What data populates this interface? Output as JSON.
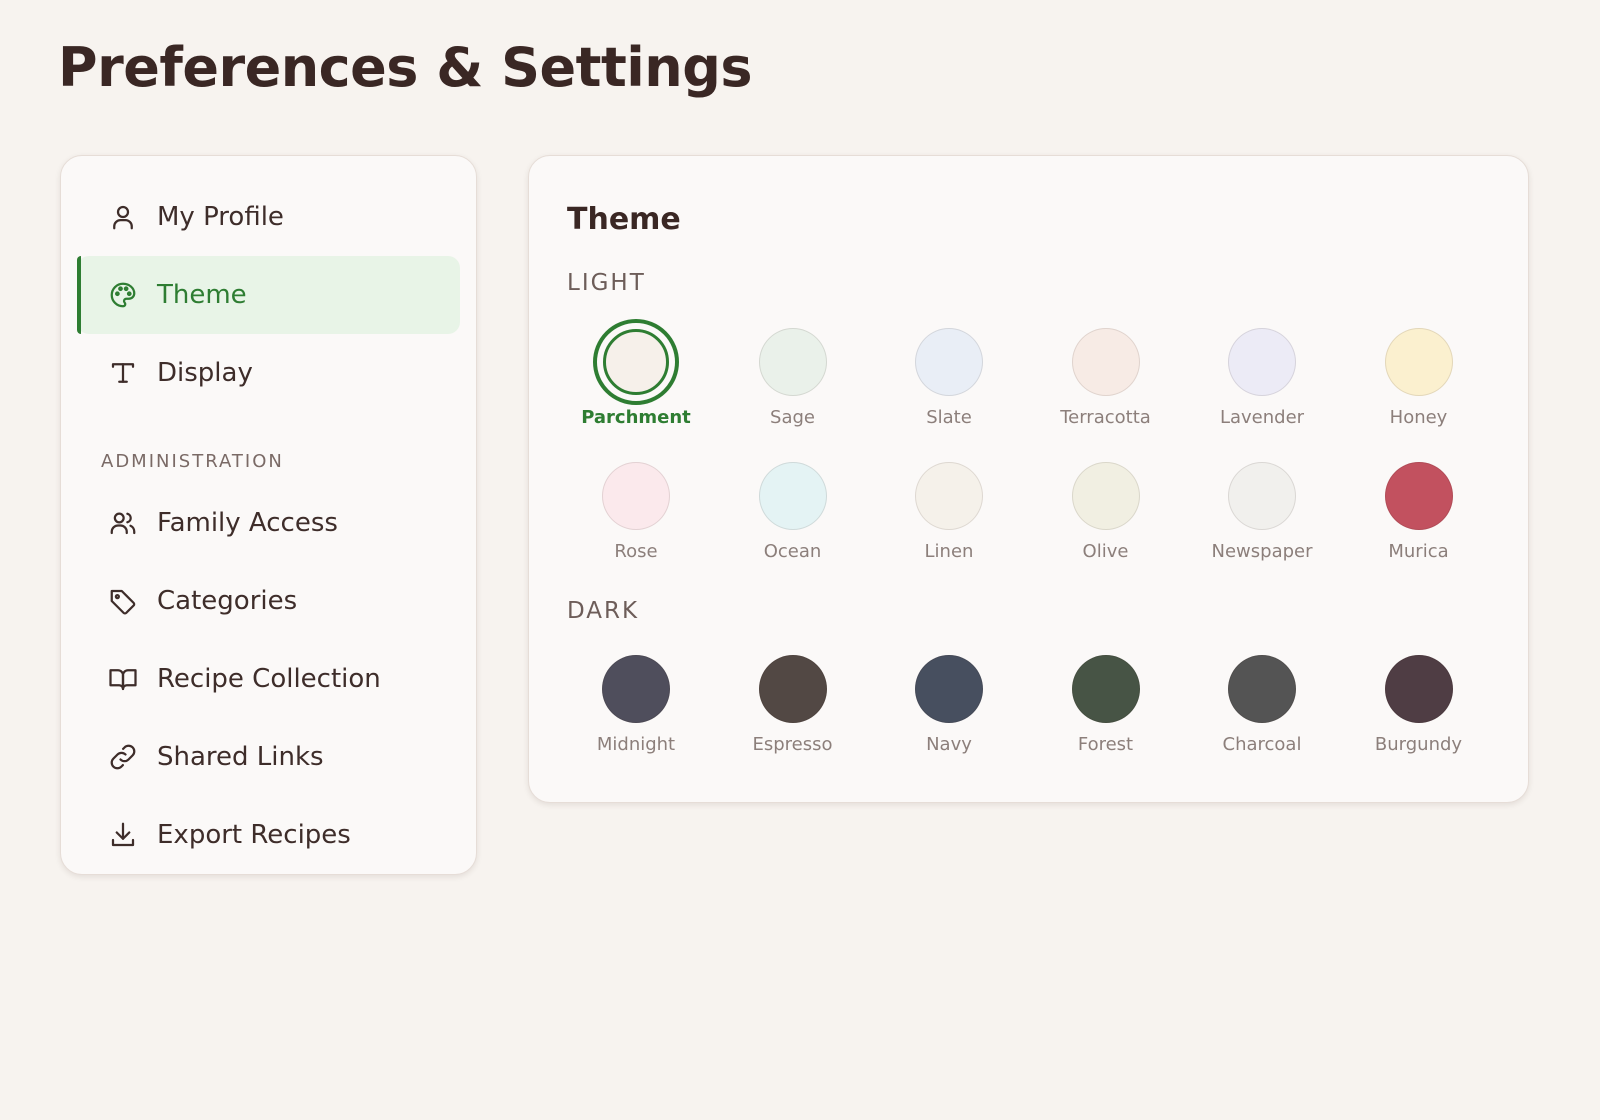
{
  "page": {
    "title": "Preferences & Settings"
  },
  "sidebar": {
    "items": [
      {
        "label": "My Profile",
        "icon": "user-icon",
        "active": false
      },
      {
        "label": "Theme",
        "icon": "palette-icon",
        "active": true
      },
      {
        "label": "Display",
        "icon": "type-icon",
        "active": false
      }
    ],
    "admin_section_label": "ADMINISTRATION",
    "admin_items": [
      {
        "label": "Family Access",
        "icon": "users-icon"
      },
      {
        "label": "Categories",
        "icon": "tag-icon"
      },
      {
        "label": "Recipe Collection",
        "icon": "book-icon"
      },
      {
        "label": "Shared Links",
        "icon": "link-icon"
      },
      {
        "label": "Export Recipes",
        "icon": "download-icon"
      }
    ]
  },
  "panel": {
    "title": "Theme",
    "light_label": "LIGHT",
    "dark_label": "DARK",
    "selected": "Parchment",
    "light_themes": [
      {
        "name": "Parchment",
        "color": "#f6f0ea"
      },
      {
        "name": "Sage",
        "color": "#eaf1ea"
      },
      {
        "name": "Slate",
        "color": "#e9eef6"
      },
      {
        "name": "Terracotta",
        "color": "#f7ebe5"
      },
      {
        "name": "Lavender",
        "color": "#ecebf6"
      },
      {
        "name": "Honey",
        "color": "#fbf0cf"
      },
      {
        "name": "Rose",
        "color": "#fbe9ec"
      },
      {
        "name": "Ocean",
        "color": "#e4f3f4"
      },
      {
        "name": "Linen",
        "color": "#f5f1ea"
      },
      {
        "name": "Olive",
        "color": "#f1efe2"
      },
      {
        "name": "Newspaper",
        "color": "#f1f0ed"
      },
      {
        "name": "Murica",
        "color": "#c2515f"
      }
    ],
    "dark_themes": [
      {
        "name": "Midnight",
        "color": "#4f4e5c"
      },
      {
        "name": "Espresso",
        "color": "#524844"
      },
      {
        "name": "Navy",
        "color": "#474f5f"
      },
      {
        "name": "Forest",
        "color": "#475445"
      },
      {
        "name": "Charcoal",
        "color": "#545454"
      },
      {
        "name": "Burgundy",
        "color": "#4f3d44"
      }
    ]
  },
  "colors": {
    "accent": "#2e7d32",
    "active_bg": "#e8f4e7",
    "background": "#f7f3ef"
  }
}
